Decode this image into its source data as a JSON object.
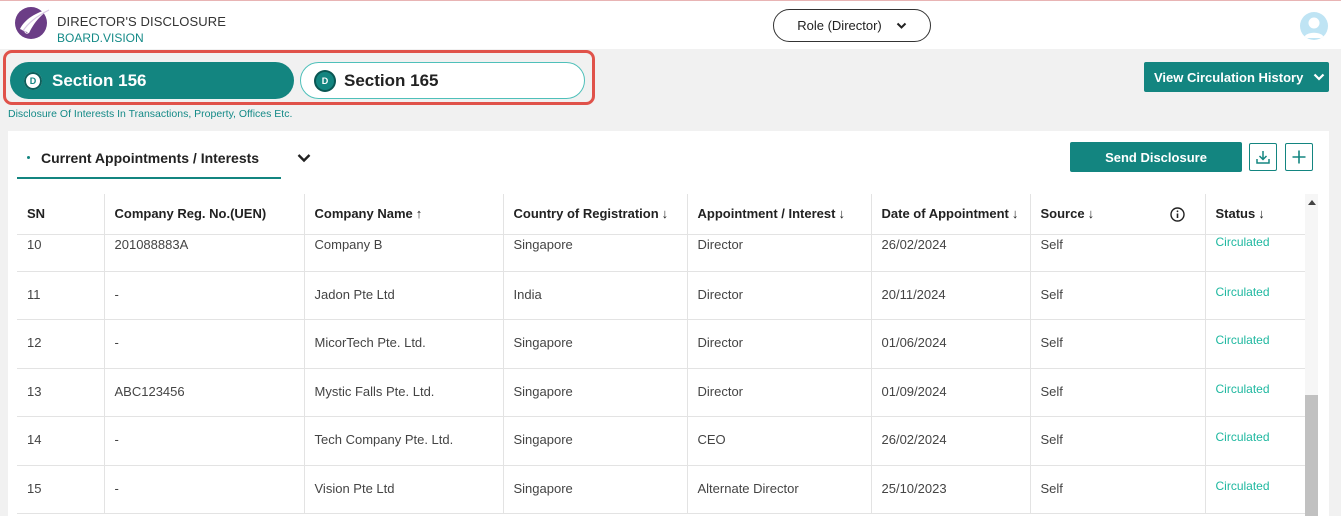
{
  "header": {
    "title": "DIRECTOR'S DISCLOSURE",
    "subtitle": "BOARD.VISION",
    "role_label": "Role (Director)"
  },
  "sections": {
    "tab1": {
      "badge": "D",
      "label": "Section 156",
      "active": true
    },
    "tab2": {
      "badge": "D",
      "label": "Section 165",
      "active": false
    },
    "description": "Disclosure Of Interests In Transactions, Property, Offices Etc."
  },
  "toolbar": {
    "view_history_label": "View Circulation History",
    "current_tab_label": "Current Appointments / Interests",
    "send_label": "Send Disclosure"
  },
  "table": {
    "columns": [
      {
        "label": "SN",
        "arrow": ""
      },
      {
        "label": "Company Reg. No.(UEN)",
        "arrow": ""
      },
      {
        "label": "Company Name",
        "arrow": "↑"
      },
      {
        "label": "Country of Registration",
        "arrow": "↓"
      },
      {
        "label": "Appointment / Interest",
        "arrow": "↓"
      },
      {
        "label": "Date of Appointment",
        "arrow": "↓"
      },
      {
        "label": "Source",
        "arrow": "↓"
      },
      {
        "label": "Status",
        "arrow": "↓"
      }
    ],
    "rows": [
      {
        "sn": "10",
        "uen": "201088883A",
        "company": "Company B",
        "country": "Singapore",
        "appointment": "Director",
        "date": "26/02/2024",
        "source": "Self",
        "status": "Circulated"
      },
      {
        "sn": "11",
        "uen": "-",
        "company": "Jadon Pte Ltd",
        "country": "India",
        "appointment": "Director",
        "date": "20/11/2024",
        "source": "Self",
        "status": "Circulated"
      },
      {
        "sn": "12",
        "uen": "-",
        "company": "MicorTech Pte. Ltd.",
        "country": "Singapore",
        "appointment": "Director",
        "date": "01/06/2024",
        "source": "Self",
        "status": "Circulated"
      },
      {
        "sn": "13",
        "uen": "ABC123456",
        "company": "Mystic Falls Pte. Ltd.",
        "country": "Singapore",
        "appointment": "Director",
        "date": "01/09/2024",
        "source": "Self",
        "status": "Circulated"
      },
      {
        "sn": "14",
        "uen": "-",
        "company": "Tech Company Pte. Ltd.",
        "country": "Singapore",
        "appointment": "CEO",
        "date": "26/02/2024",
        "source": "Self",
        "status": "Circulated"
      },
      {
        "sn": "15",
        "uen": "-",
        "company": "Vision Pte Ltd",
        "country": "Singapore",
        "appointment": "Alternate Director",
        "date": "25/10/2023",
        "source": "Self",
        "status": "Circulated"
      }
    ]
  },
  "colors": {
    "accent": "#138580",
    "status": "#1fb8a0",
    "highlight": "#e0524a"
  }
}
